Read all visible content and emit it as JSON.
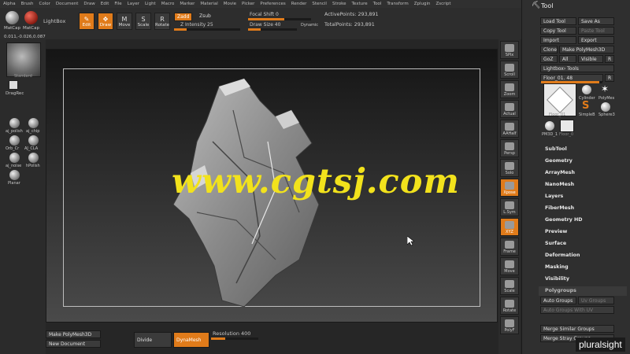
{
  "menu": [
    "Alpha",
    "Brush",
    "Color",
    "Document",
    "Draw",
    "Edit",
    "File",
    "Layer",
    "Light",
    "Macro",
    "Marker",
    "Material",
    "Movie",
    "Picker",
    "Preferences",
    "Render",
    "Stencil",
    "Stroke",
    "Texture",
    "Tool",
    "Transform",
    "Zplugin",
    "Zscript"
  ],
  "topshelf": {
    "matcap1": "MatCap",
    "matcap2": "MatCap",
    "lightbox": "LightBox",
    "edit": "Edit",
    "draw": "Draw",
    "move": "Move",
    "scale": "Scale",
    "rotate": "Rotate",
    "zadd": "Zadd",
    "zsub": "Zsub",
    "z_intensity": "Z Intensity 25",
    "focal_shift": "Focal Shift 0",
    "draw_size": "Draw Size 40",
    "dynamic": "Dynamic",
    "active_points": "ActivePoints: 293,891",
    "total_points": "TotalPoints: 293,891",
    "coords": "0.011,-0.026,0.087"
  },
  "leftshelf": {
    "standard": "Standard",
    "dragrec": "DragRec",
    "brushes": [
      "aj_polish",
      "aj_chip",
      "Orb_Cr",
      "AJ_CLA",
      "aj_noise",
      "hPolish",
      "Planar"
    ]
  },
  "rightshelf": [
    "SPix",
    "Scroll",
    "Zoom",
    "Actual",
    "AAHalf",
    "Persp",
    "Solo",
    "Xpose",
    "L.Sym",
    "XYZ",
    "Frame",
    "Move",
    "Scale",
    "Rotate",
    "PolyF"
  ],
  "palette": {
    "title": "Tool",
    "load_tool": "Load Tool",
    "save_as": "Save As",
    "copy_tool": "Copy Tool",
    "paste_tool": "Paste Tool",
    "import": "Import",
    "export": "Export",
    "clone": "Clone",
    "make_polymesh": "Make PolyMesh3D",
    "goz": "GoZ",
    "all": "All",
    "visible": "Visible",
    "r": "R",
    "lightbox_tools": "Lightbox› Tools",
    "floor_slider": "Floor_01. 48",
    "thumbs": [
      "Floor_01",
      "Cylinder",
      "PolyMes",
      "SimpleB",
      "Sphere3",
      "PM3D_1",
      "Floor_0"
    ],
    "sections": [
      "SubTool",
      "Geometry",
      "ArrayMesh",
      "NanoMesh",
      "Layers",
      "FiberMesh",
      "Geometry HD",
      "Preview",
      "Surface",
      "Deformation",
      "Masking",
      "Visibility",
      "Polygroups"
    ],
    "auto_groups": "Auto Groups",
    "uv_groups": "Uv Groups",
    "auto_groups_uv": "Auto Groups With UV",
    "merge_similar": "Merge Similar Groups",
    "merge_stray": "Merge Stray Groups"
  },
  "bottombar": {
    "make_polymesh": "Make PolyMesh3D",
    "new_document": "New Document",
    "divide": "Divide",
    "dynamesh": "DynaMesh",
    "resolution": "Resolution 400"
  },
  "watermark": "www.cgtsj.com",
  "logo": "pluralsight",
  "colors": {
    "accent": "#e07b1a",
    "watermark": "#f2e21c"
  }
}
